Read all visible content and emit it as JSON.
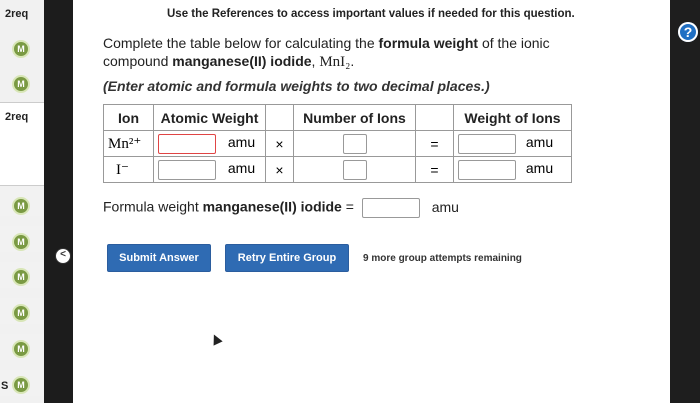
{
  "sidebar": {
    "req1": "2req",
    "req2": "2req",
    "dot_label": "M",
    "fragments": [
      "",
      "",
      "",
      "",
      "",
      "S"
    ]
  },
  "collapse_glyph": "<",
  "question": {
    "header": "Use the References to access important values if needed for this question.",
    "line1_prefix": "Complete the table below for calculating the ",
    "line1_bold": "formula weight",
    "line1_suffix": " of the ionic",
    "line2_prefix": "compound ",
    "line2_bold": "manganese(II) iodide",
    "line2_sep": ", ",
    "formula": "MnI₂",
    "line2_end": ".",
    "note": "(Enter atomic and formula weights to two decimal places.)"
  },
  "table": {
    "headers": [
      "Ion",
      "Atomic Weight",
      "Number of Ions",
      "Weight of Ions"
    ],
    "rows": [
      {
        "ion": "Mn²⁺",
        "unit": "amu",
        "times": "×",
        "equals": "=",
        "unit2": "amu"
      },
      {
        "ion": "I⁻",
        "unit": "amu",
        "times": "×",
        "equals": "=",
        "unit2": "amu"
      }
    ]
  },
  "formula_weight": {
    "label_prefix": "Formula weight ",
    "label_bold": "manganese(II) iodide",
    "label_eq": " =",
    "unit": "amu"
  },
  "buttons": {
    "submit": "Submit Answer",
    "retry": "Retry Entire Group"
  },
  "attempts": "9 more group attempts remaining",
  "help_glyph": "?",
  "colors": {
    "button_blue": "#2f6bb3",
    "error_red": "#e04545",
    "badge_green": "#7a9a43"
  }
}
